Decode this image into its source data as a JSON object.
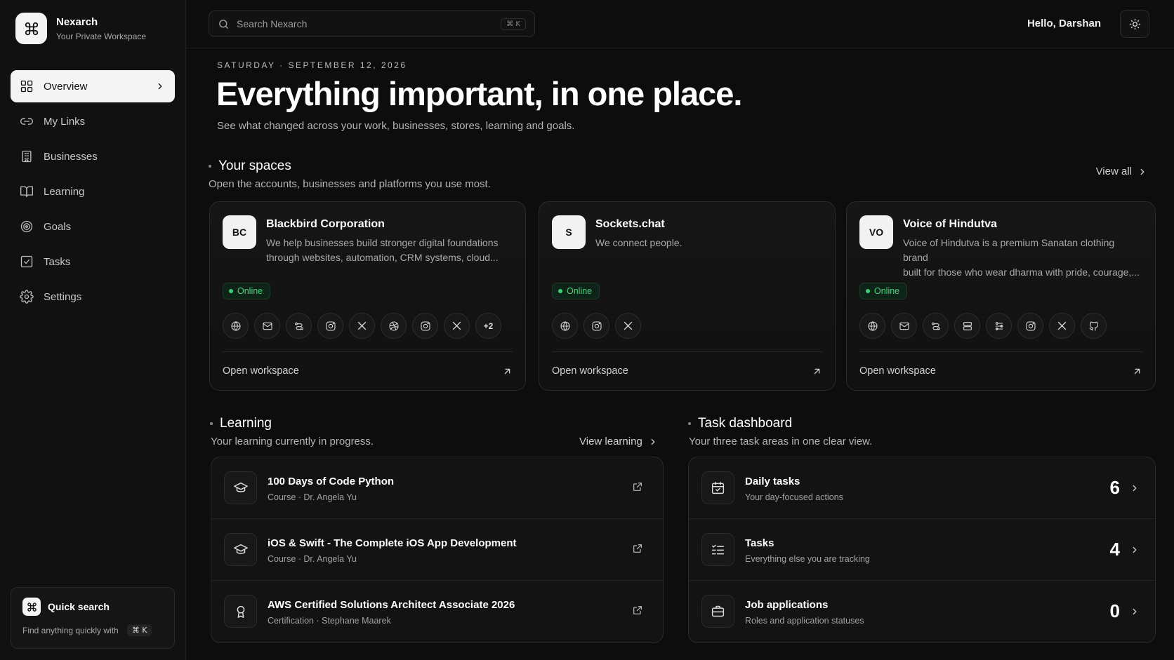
{
  "app": {
    "name": "Nexarch",
    "subtitle": "Your Private Workspace"
  },
  "sidebar": {
    "items": [
      {
        "label": "Overview",
        "icon": "grid-icon",
        "active": true
      },
      {
        "label": "My Links",
        "icon": "link-icon"
      },
      {
        "label": "Businesses",
        "icon": "building-icon"
      },
      {
        "label": "Learning",
        "icon": "book-icon"
      },
      {
        "label": "Goals",
        "icon": "target-icon"
      },
      {
        "label": "Tasks",
        "icon": "checkbox-icon"
      },
      {
        "label": "Settings",
        "icon": "gear-icon"
      }
    ],
    "quick_search": {
      "title": "Quick search",
      "hint": "Find anything quickly with",
      "shortcut": "⌘ K"
    }
  },
  "topbar": {
    "search_placeholder": "Search Nexarch",
    "search_shortcut": "⌘ K",
    "greeting": "Hello,  Darshan"
  },
  "hero": {
    "date": "SATURDAY · SEPTEMBER 12, 2026",
    "title": "Everything important, in one place.",
    "subtitle": "See what changed across your work, businesses, stores, learning and goals."
  },
  "spaces": {
    "title": "Your spaces",
    "description": "Open the accounts, businesses and platforms you use most.",
    "view_all": "View all",
    "cards": [
      {
        "initials": "BC",
        "name": "Blackbird Corporation",
        "desc_line1": "We help businesses build stronger digital foundations",
        "desc_line2": "through websites, automation, CRM systems, cloud...",
        "status": "Online",
        "more": "+2",
        "open": "Open workspace"
      },
      {
        "initials": "S",
        "name": "Sockets.chat",
        "desc_line1": "We connect people.",
        "desc_line2": "",
        "status": "Online",
        "open": "Open workspace"
      },
      {
        "initials": "VO",
        "name": "Voice of Hindutva",
        "desc_line1": "Voice of Hindutva is a premium Sanatan clothing brand",
        "desc_line2": "built for those who wear dharma with pride, courage,...",
        "status": "Online",
        "open": "Open workspace"
      }
    ]
  },
  "learning": {
    "title": "Learning",
    "description": "Your learning currently in progress.",
    "view": "View learning",
    "items": [
      {
        "title": "100 Days of Code Python",
        "sub": "Course · Dr. Angela Yu",
        "icon": "graduation-cap-icon"
      },
      {
        "title": "iOS & Swift - The Complete iOS App Development",
        "sub": "Course · Dr. Angela Yu",
        "icon": "graduation-cap-icon"
      },
      {
        "title": "AWS Certified Solutions Architect Associate 2026",
        "sub": "Certification · Stephane Maarek",
        "icon": "award-icon"
      }
    ]
  },
  "tasks": {
    "title": "Task dashboard",
    "description": "Your three task areas in one clear view.",
    "items": [
      {
        "title": "Daily tasks",
        "sub": "Your day-focused actions",
        "count": "6",
        "icon": "calendar-check-icon"
      },
      {
        "title": "Tasks",
        "sub": "Everything else you are tracking",
        "count": "4",
        "icon": "list-check-icon"
      },
      {
        "title": "Job applications",
        "sub": "Roles and application statuses",
        "count": "0",
        "icon": "briefcase-icon"
      }
    ]
  },
  "colors": {
    "background": "#0d0d0d",
    "online_green": "#3fd178",
    "active_nav": "#f4f4f4"
  }
}
